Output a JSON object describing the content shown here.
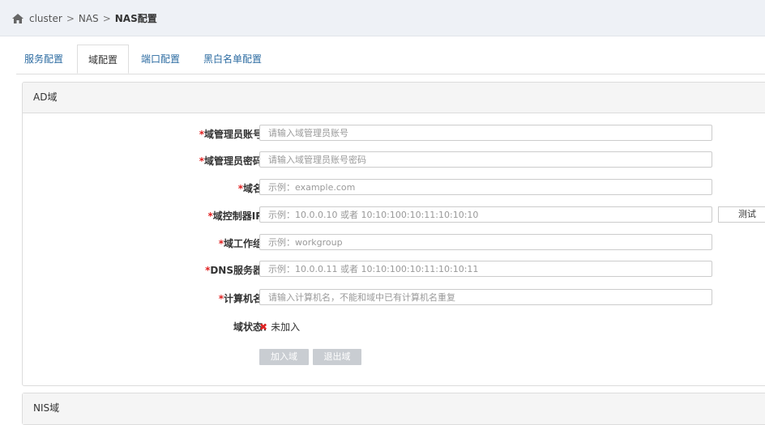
{
  "breadcrumb": {
    "items": [
      "cluster",
      "NAS",
      "NAS配置"
    ],
    "separator": ">"
  },
  "tabs": [
    {
      "label": "服务配置",
      "active": false
    },
    {
      "label": "域配置",
      "active": true
    },
    {
      "label": "端口配置",
      "active": false
    },
    {
      "label": "黑白名单配置",
      "active": false
    }
  ],
  "ad_panel": {
    "title": "AD域",
    "fields": [
      {
        "label": "域管理员账号：",
        "required": true,
        "placeholder": "请输入域管理员账号",
        "value": ""
      },
      {
        "label": "域管理员密码：",
        "required": true,
        "placeholder": "请输入域管理员账号密码",
        "value": ""
      },
      {
        "label": "域名：",
        "required": true,
        "placeholder": "示例：example.com",
        "value": ""
      },
      {
        "label": "域控制器IP：",
        "required": true,
        "placeholder": "示例：10.0.0.10 或者 10:10:100:10:11:10:10:10",
        "value": ""
      },
      {
        "label": "域工作组：",
        "required": true,
        "placeholder": "示例：workgroup",
        "value": ""
      },
      {
        "label": "DNS服务器：",
        "required": true,
        "placeholder": "示例：10.0.0.11 或者 10:10:100:10:11:10:10:11",
        "value": ""
      },
      {
        "label": "计算机名：",
        "required": true,
        "placeholder": "请输入计算机名，不能和域中已有计算机名重复",
        "value": ""
      }
    ],
    "required_mark": "*",
    "test_button": "测试",
    "status_label": "域状态：",
    "status_icon": "x-icon",
    "status_value": "未加入",
    "status_color": "#e02020",
    "join_button": "加入域",
    "leave_button": "退出域"
  },
  "nis_panel": {
    "title": "NIS域"
  },
  "colors": {
    "link": "#2d6ca2",
    "topbar": "#eef1f6",
    "disabled_button": "#c9cdd2"
  }
}
